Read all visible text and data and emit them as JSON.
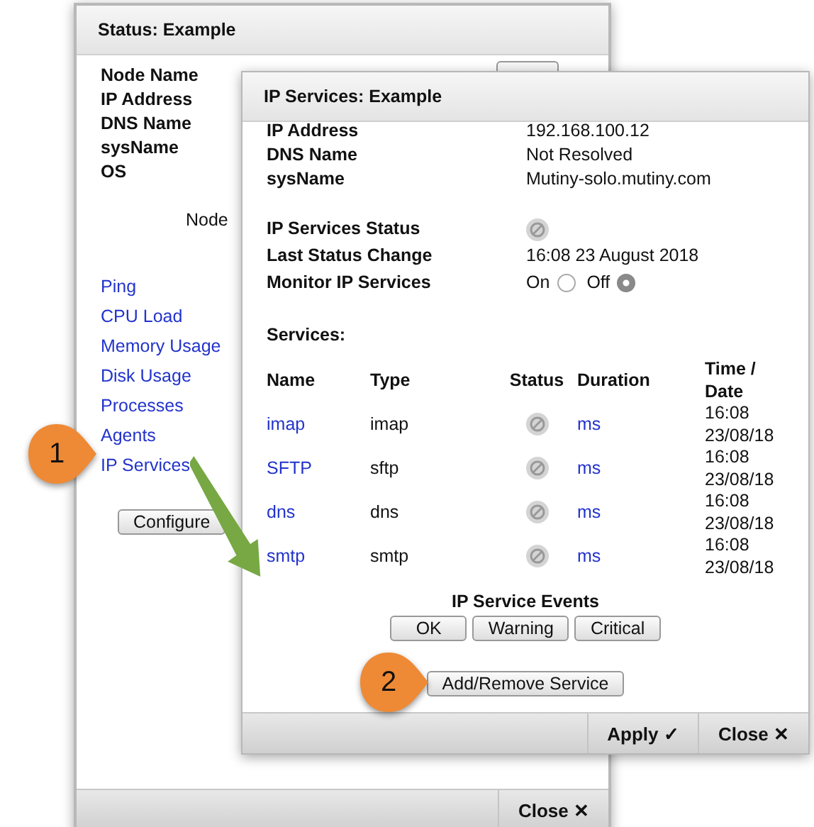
{
  "back_window": {
    "title": "Status: Example",
    "fields": [
      {
        "label": "Node Name"
      },
      {
        "label": "IP Address"
      },
      {
        "label": "DNS Name"
      },
      {
        "label": "sysName"
      },
      {
        "label": "OS"
      }
    ],
    "partial_text": "Node",
    "links": [
      "Ping",
      "CPU Load",
      "Memory Usage",
      "Disk Usage",
      "Processes",
      "Agents",
      "IP Services"
    ],
    "configure_button": "Configure",
    "close_button": "Close ✕"
  },
  "front_window": {
    "title": "IP Services: Example",
    "fields": [
      {
        "label": "IP Address",
        "value": "192.168.100.12"
      },
      {
        "label": "DNS Name",
        "value": "Not Resolved"
      },
      {
        "label": "sysName",
        "value": "Mutiny-solo.mutiny.com"
      }
    ],
    "status_label": "IP Services Status",
    "last_change_label": "Last Status Change",
    "last_change_value": "16:08 23 August 2018",
    "monitor_label": "Monitor IP Services",
    "monitor_options": [
      {
        "label": "On",
        "selected": false
      },
      {
        "label": "Off",
        "selected": true
      }
    ],
    "services_heading": "Services:",
    "table": {
      "columns": [
        "Name",
        "Type",
        "Status",
        "Duration",
        "Time / Date"
      ],
      "rows": [
        {
          "name": "imap",
          "type": "imap",
          "duration": "ms",
          "time": "16:08",
          "date": "23/08/18"
        },
        {
          "name": "SFTP",
          "type": "sftp",
          "duration": "ms",
          "time": "16:08",
          "date": "23/08/18"
        },
        {
          "name": "dns",
          "type": "dns",
          "duration": "ms",
          "time": "16:08",
          "date": "23/08/18"
        },
        {
          "name": "smtp",
          "type": "smtp",
          "duration": "ms",
          "time": "16:08",
          "date": "23/08/18"
        }
      ]
    },
    "events_heading": "IP Service Events",
    "event_buttons": [
      "OK",
      "Warning",
      "Critical"
    ],
    "add_remove_button": "Add/Remove Service",
    "footer_buttons": [
      "Apply ✓",
      "Close ✕"
    ]
  },
  "callouts": [
    "1",
    "2"
  ]
}
